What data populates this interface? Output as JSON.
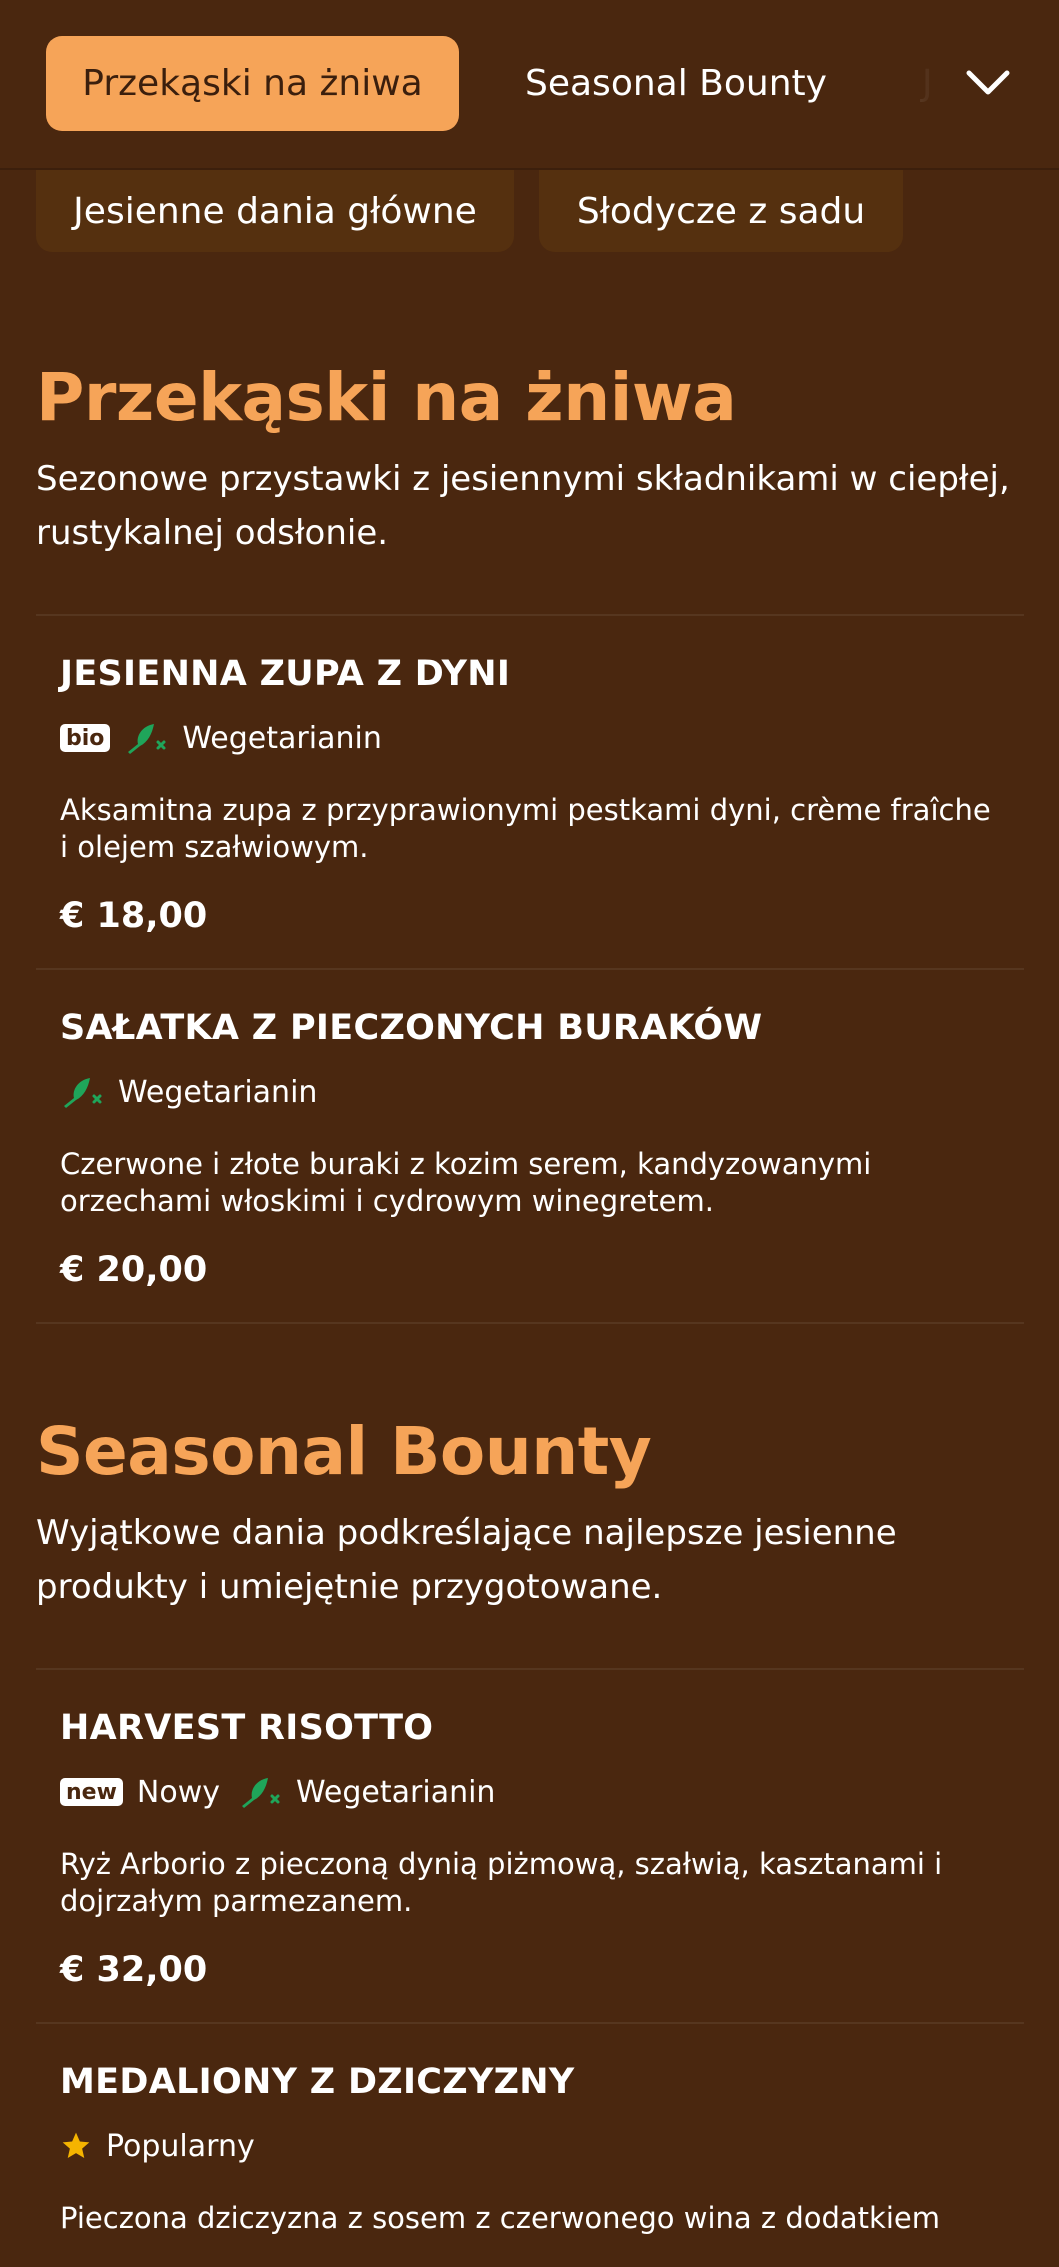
{
  "nav": {
    "active_tab": "Przekąski na żniwa",
    "tabs": [
      "Seasonal Bounty",
      "J"
    ],
    "chips": [
      "Jesienne dania główne",
      "Słodycze z sadu"
    ],
    "chevron_icon": "chevron-down-icon"
  },
  "sections": [
    {
      "title": "Przekąski na żniwa",
      "description": "Sezonowe przystawki z jesiennymi składnikami w ciepłej, rustykalnej odsłonie.",
      "items": [
        {
          "name": "JESIENNA ZUPA Z DYNI",
          "badge": "bio",
          "diet": "Wegetarianin",
          "description": "Aksamitna zupa z przyprawionymi pestkami dyni, crème fraîche i olejem szałwiowym.",
          "price": "€ 18,00"
        },
        {
          "name": "SAŁATKA Z PIECZONYCH BURAKÓW",
          "diet": "Wegetarianin",
          "description": "Czerwone i złote buraki z kozim serem, kandyzowanymi orzechami włoskimi i cydrowym winegretem.",
          "price": "€ 20,00"
        }
      ]
    },
    {
      "title": "Seasonal Bounty",
      "description": "Wyjątkowe dania podkreślające najlepsze jesienne produkty i umiejętnie przygotowane.",
      "items": [
        {
          "name": "HARVEST RISOTTO",
          "badge": "new",
          "badge_label": "Nowy",
          "diet": "Wegetarianin",
          "description": "Ryż Arborio z pieczoną dynią piżmową, szałwią, kasztanami i dojrzałym parmezanem.",
          "price": "€ 32,00"
        },
        {
          "name": "MEDALIONY Z DZICZYZNY",
          "popular_label": "Popularny",
          "description": "Pieczona dziczyzna z sosem z czerwonego wina z dodatkiem"
        }
      ]
    }
  ],
  "colors": {
    "background": "#4a270f",
    "accent": "#f6a458",
    "veg_icon": "#1fa55a",
    "star": "#f5b400"
  }
}
